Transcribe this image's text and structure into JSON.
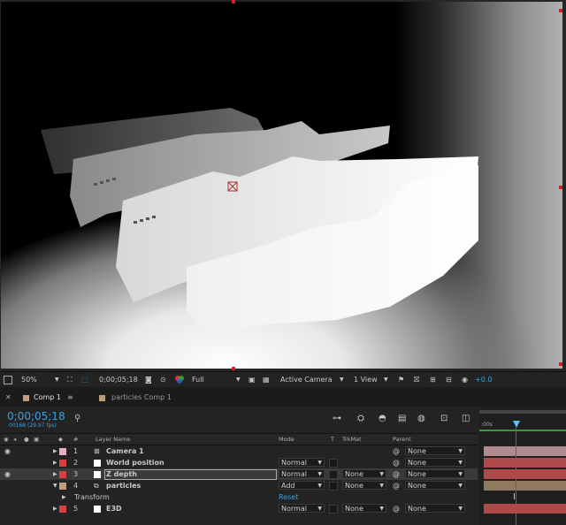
{
  "viewer": {
    "zoom": "50%",
    "timecode": "0;00;05;18",
    "resolution": "Full",
    "camera": "Active Camera",
    "view": "1 View",
    "exposure": "+0.0"
  },
  "tabs": [
    {
      "label": "Comp 1"
    },
    {
      "label": "particles Comp 1"
    }
  ],
  "timeline": {
    "timecode": "0;00;05;18",
    "frameinfo": "00168 (29.97 fps)",
    "ruler_label": ":00s",
    "headers": {
      "num": "#",
      "layer_name": "Layer Name",
      "mode": "Mode",
      "t": "T",
      "trkmat": "TrkMat",
      "parent": "Parent"
    },
    "layers": [
      {
        "num": "1",
        "name": "Camera 1",
        "label_color": "#e6b0c0",
        "mode": "",
        "trkmat": "",
        "parent": "None",
        "bar_color": "#b08a90"
      },
      {
        "num": "2",
        "name": "World position",
        "label_color": "#d84040",
        "mode": "Normal",
        "trkmat": "",
        "parent": "None",
        "bar_color": "#b04a4a"
      },
      {
        "num": "3",
        "name": "Z depth",
        "label_color": "#d84040",
        "mode": "Normal",
        "trkmat": "None",
        "parent": "None",
        "bar_color": "#b04a4a"
      },
      {
        "num": "4",
        "name": "particles",
        "label_color": "#bba080",
        "mode": "Add",
        "trkmat": "None",
        "parent": "None",
        "bar_color": "#8e7a60"
      },
      {
        "num": "5",
        "name": "E3D",
        "label_color": "#d84040",
        "mode": "Normal",
        "trkmat": "None",
        "parent": "None",
        "bar_color": "#b04a4a"
      }
    ],
    "transform": {
      "label": "Transform",
      "reset": "Reset"
    }
  },
  "icons": [
    "eye-icon",
    "speaker-icon",
    "solo-icon",
    "lock-icon",
    "label-icon",
    "search-icon",
    "camera-icon",
    "color-wheel-icon"
  ]
}
